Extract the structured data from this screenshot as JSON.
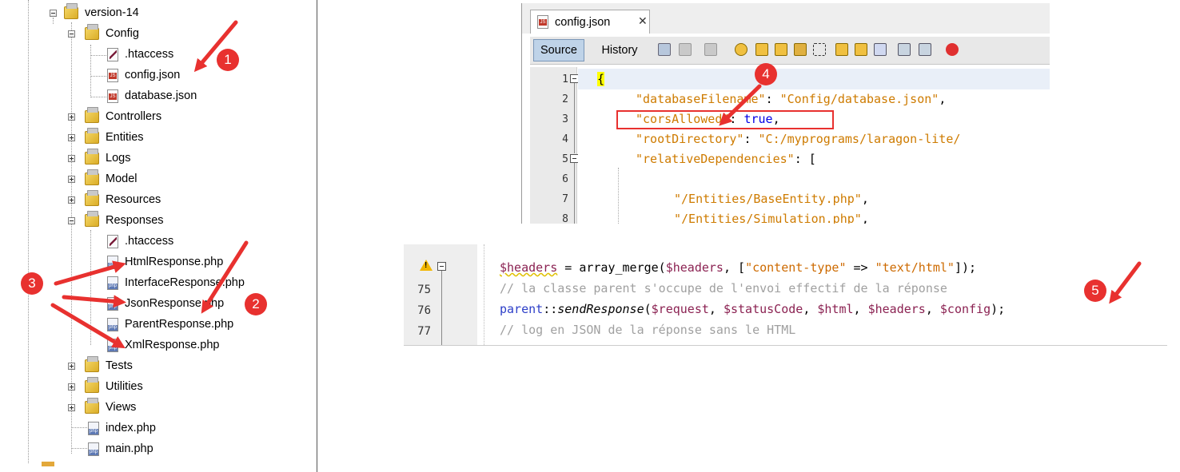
{
  "tree": {
    "items": [
      {
        "label": "version-14",
        "type": "folder",
        "expander": "minus"
      },
      {
        "label": "Config",
        "type": "folder",
        "expander": "minus"
      },
      {
        "label": ".htaccess",
        "type": "htaccess"
      },
      {
        "label": "config.json",
        "type": "json"
      },
      {
        "label": "database.json",
        "type": "json"
      },
      {
        "label": "Controllers",
        "type": "folder",
        "expander": "plus"
      },
      {
        "label": "Entities",
        "type": "folder",
        "expander": "plus"
      },
      {
        "label": "Logs",
        "type": "folder",
        "expander": "plus"
      },
      {
        "label": "Model",
        "type": "folder",
        "expander": "plus"
      },
      {
        "label": "Resources",
        "type": "folder",
        "expander": "plus"
      },
      {
        "label": "Responses",
        "type": "folder",
        "expander": "minus"
      },
      {
        "label": ".htaccess",
        "type": "htaccess"
      },
      {
        "label": "HtmlResponse.php",
        "type": "php"
      },
      {
        "label": "InterfaceResponse.php",
        "type": "php"
      },
      {
        "label": "JsonResponse.php",
        "type": "php"
      },
      {
        "label": "ParentResponse.php",
        "type": "php"
      },
      {
        "label": "XmlResponse.php",
        "type": "php"
      },
      {
        "label": "Tests",
        "type": "folder",
        "expander": "plus"
      },
      {
        "label": "Utilities",
        "type": "folder",
        "expander": "plus"
      },
      {
        "label": "Views",
        "type": "folder",
        "expander": "plus"
      },
      {
        "label": "index.php",
        "type": "php"
      },
      {
        "label": "main.php",
        "type": "php"
      }
    ]
  },
  "config_editor": {
    "tab_label": "config.json",
    "close_glyph": "✕",
    "source_label": "Source",
    "history_label": "History",
    "line_numbers": [
      "1",
      "2",
      "3",
      "4",
      "5",
      "6",
      "7",
      "8"
    ],
    "lines": {
      "l1": "{",
      "l2_key": "\"databaseFilename\"",
      "l2_val": "\"Config/database.json\"",
      "l3_key": "\"corsAllowed\"",
      "l3_val": "true",
      "l4_key": "\"rootDirectory\"",
      "l4_val": "\"C:/myprograms/laragon-lite/",
      "l5_key": "\"relativeDependencies\"",
      "l5_rest": ": [",
      "l7_val": "\"/Entities/BaseEntity.php\"",
      "l8_val": "\"/Entities/Simulation.php\""
    },
    "punct": {
      "colon": ": ",
      "comma": ","
    }
  },
  "php_editor": {
    "line_numbers": [
      "75",
      "76",
      "77"
    ],
    "l74": {
      "var1": "$headers",
      "mid": " = array_merge(",
      "var2": "$headers",
      "mid2": ", [",
      "s1": "\"content-type\"",
      "arrow": " => ",
      "s2": "\"text/html\"",
      "end": "]);"
    },
    "l75": "// la classe parent s'occupe de l'envoi effectif de la réponse",
    "l76": {
      "parent": "parent",
      "sep": "::",
      "fn": "sendResponse",
      "open": "(",
      "v1": "$request",
      "v2": "$statusCode",
      "v3": "$html",
      "v4": "$headers",
      "v5": "$config",
      "comma": ", ",
      "close": ");"
    },
    "l77": "// log en JSON de la réponse sans le HTML"
  },
  "annotations": {
    "badges": [
      "1",
      "2",
      "3",
      "4",
      "5"
    ],
    "accent_color": "#e8312f"
  }
}
